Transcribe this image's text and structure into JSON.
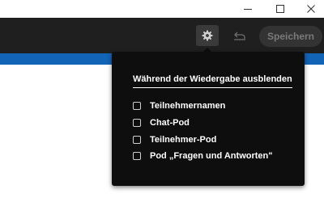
{
  "window": {
    "minimize_icon": "minimize-icon",
    "maximize_icon": "maximize-icon",
    "close_icon": "close-icon"
  },
  "toolbar": {
    "settings_icon": "gear-icon",
    "undo_icon": "undo-icon",
    "save_label": "Speichern"
  },
  "menu": {
    "heading": "Während der Wiedergabe ausblenden",
    "options": [
      {
        "label": "Teilnehmernamen",
        "checked": false
      },
      {
        "label": "Chat-Pod",
        "checked": false
      },
      {
        "label": "Teilnehmer-Pod",
        "checked": false
      },
      {
        "label": "Pod „Fragen und Antworten\"",
        "checked": false
      }
    ]
  },
  "colors": {
    "toolbar_bg": "#1f1f1f",
    "accent_blue": "#1264b6",
    "menu_bg": "#0e0e0e",
    "save_text": "#7a7a7a"
  }
}
